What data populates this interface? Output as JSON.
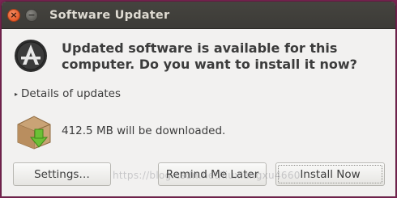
{
  "window": {
    "title": "Software Updater"
  },
  "titlebar": {
    "close_glyph": "×",
    "minimize_glyph": "−"
  },
  "header": {
    "icon": "software-updater-icon",
    "message": "Updated software is available for this computer. Do you want to install it now?"
  },
  "details": {
    "arrow_glyph": "▸",
    "label": "Details of updates",
    "expanded": false
  },
  "download": {
    "icon": "package-download-icon",
    "text": "412.5 MB will be downloaded."
  },
  "buttons": {
    "settings_label": "Settings…",
    "remind_label": "Remind Me Later",
    "install_label": "Install Now"
  },
  "watermark": {
    "text": "https://blog.csdn.net/liuxiangxu4660"
  },
  "colors": {
    "titlebar": "#3c3b37",
    "close_button": "#e35a2a",
    "window_bg": "#f2f1f0",
    "text": "#3c3c3c",
    "desktop": "#7a2452"
  }
}
